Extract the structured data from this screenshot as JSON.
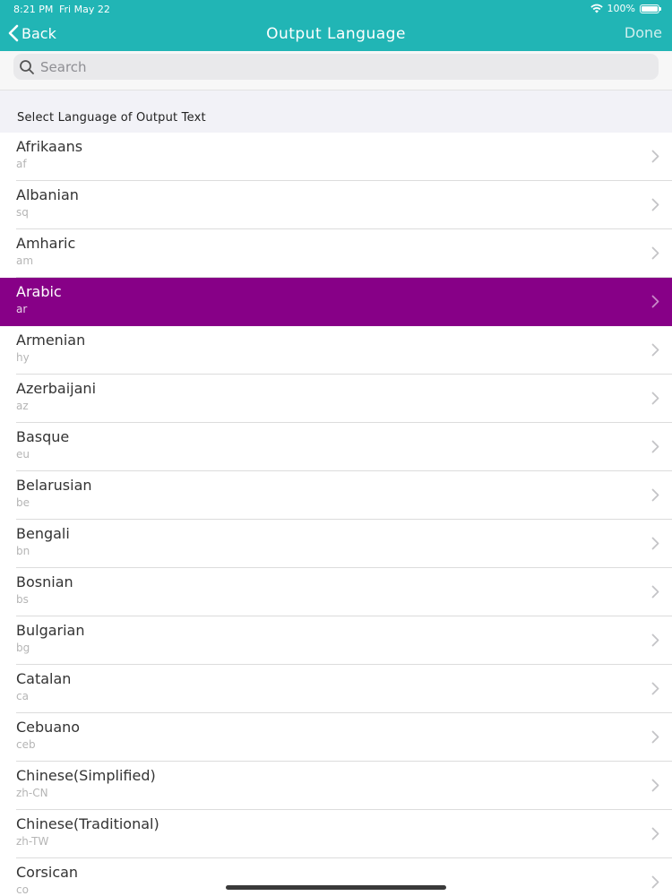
{
  "status_bar": {
    "time": "8:21 PM",
    "date": "Fri May 22",
    "battery_percent": "100%"
  },
  "nav": {
    "back_label": "Back",
    "title": "Output Language",
    "done_label": "Done"
  },
  "search": {
    "placeholder": "Search",
    "value": ""
  },
  "section": {
    "header": "Select Language of Output Text"
  },
  "languages": [
    {
      "name": "Afrikaans",
      "code": "af",
      "selected": false
    },
    {
      "name": "Albanian",
      "code": "sq",
      "selected": false
    },
    {
      "name": "Amharic",
      "code": "am",
      "selected": false
    },
    {
      "name": "Arabic",
      "code": "ar",
      "selected": true
    },
    {
      "name": "Armenian",
      "code": "hy",
      "selected": false
    },
    {
      "name": "Azerbaijani",
      "code": "az",
      "selected": false
    },
    {
      "name": "Basque",
      "code": "eu",
      "selected": false
    },
    {
      "name": "Belarusian",
      "code": "be",
      "selected": false
    },
    {
      "name": "Bengali",
      "code": "bn",
      "selected": false
    },
    {
      "name": "Bosnian",
      "code": "bs",
      "selected": false
    },
    {
      "name": "Bulgarian",
      "code": "bg",
      "selected": false
    },
    {
      "name": "Catalan",
      "code": "ca",
      "selected": false
    },
    {
      "name": "Cebuano",
      "code": "ceb",
      "selected": false
    },
    {
      "name": "Chinese(Simplified)",
      "code": "zh-CN",
      "selected": false
    },
    {
      "name": "Chinese(Traditional)",
      "code": "zh-TW",
      "selected": false
    },
    {
      "name": "Corsican",
      "code": "co",
      "selected": false
    }
  ],
  "colors": {
    "accent": "#21b5b5",
    "selected_row": "#870087"
  },
  "icons": {
    "back": "chevron-left-icon",
    "row": "chevron-right-icon",
    "search": "search-icon",
    "wifi": "wifi-icon",
    "battery": "battery-icon"
  }
}
